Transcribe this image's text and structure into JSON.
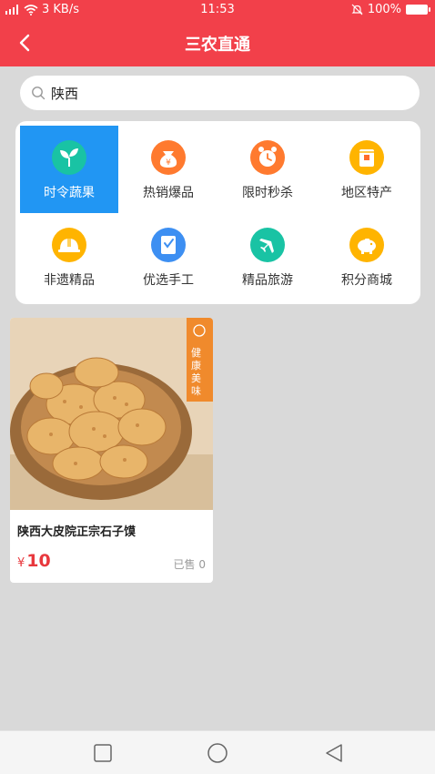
{
  "status_bar": {
    "signal": "4G",
    "speed": "3 KB/s",
    "time": "11:53",
    "battery": "100%"
  },
  "header": {
    "title": "三农直通"
  },
  "search": {
    "value": "陕西",
    "placeholder": ""
  },
  "categories": [
    {
      "label": "时令蔬果",
      "icon": "sprout-icon",
      "color": "#19c3a4",
      "active": true
    },
    {
      "label": "热销爆品",
      "icon": "money-bag-icon",
      "color": "#ff7a2f",
      "active": false
    },
    {
      "label": "限时秒杀",
      "icon": "alarm-clock-icon",
      "color": "#ff7a2f",
      "active": false
    },
    {
      "label": "地区特产",
      "icon": "gift-box-icon",
      "color": "#ffb400",
      "active": false
    },
    {
      "label": "非遗精品",
      "icon": "helmet-icon",
      "color": "#ffb400",
      "active": false
    },
    {
      "label": "优选手工",
      "icon": "notebook-icon",
      "color": "#3d8ff2",
      "active": false
    },
    {
      "label": "精品旅游",
      "icon": "airplane-icon",
      "color": "#19c3a4",
      "active": false
    },
    {
      "label": "积分商城",
      "icon": "piggy-bank-icon",
      "color": "#ffb400",
      "active": false
    }
  ],
  "products": [
    {
      "name": "陕西大皮院正宗石子馍",
      "currency": "¥",
      "price": "10",
      "sold": "已售 0",
      "badge_text": "健康美味"
    }
  ],
  "colors": {
    "brand_red": "#f2404a",
    "active_blue": "#2196f3",
    "price_red": "#e8383d"
  }
}
